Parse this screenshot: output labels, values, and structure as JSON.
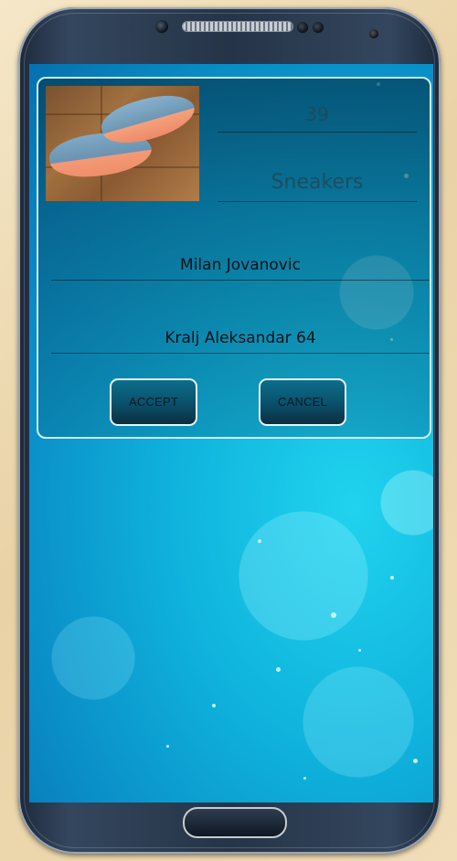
{
  "order_dialog": {
    "size_value": "39",
    "item_type": "Sneakers",
    "customer_name": "Milan Jovanovic",
    "address": "Kralj Aleksandar 64",
    "accept_label": "ACCEPT",
    "cancel_label": "CANCEL"
  }
}
